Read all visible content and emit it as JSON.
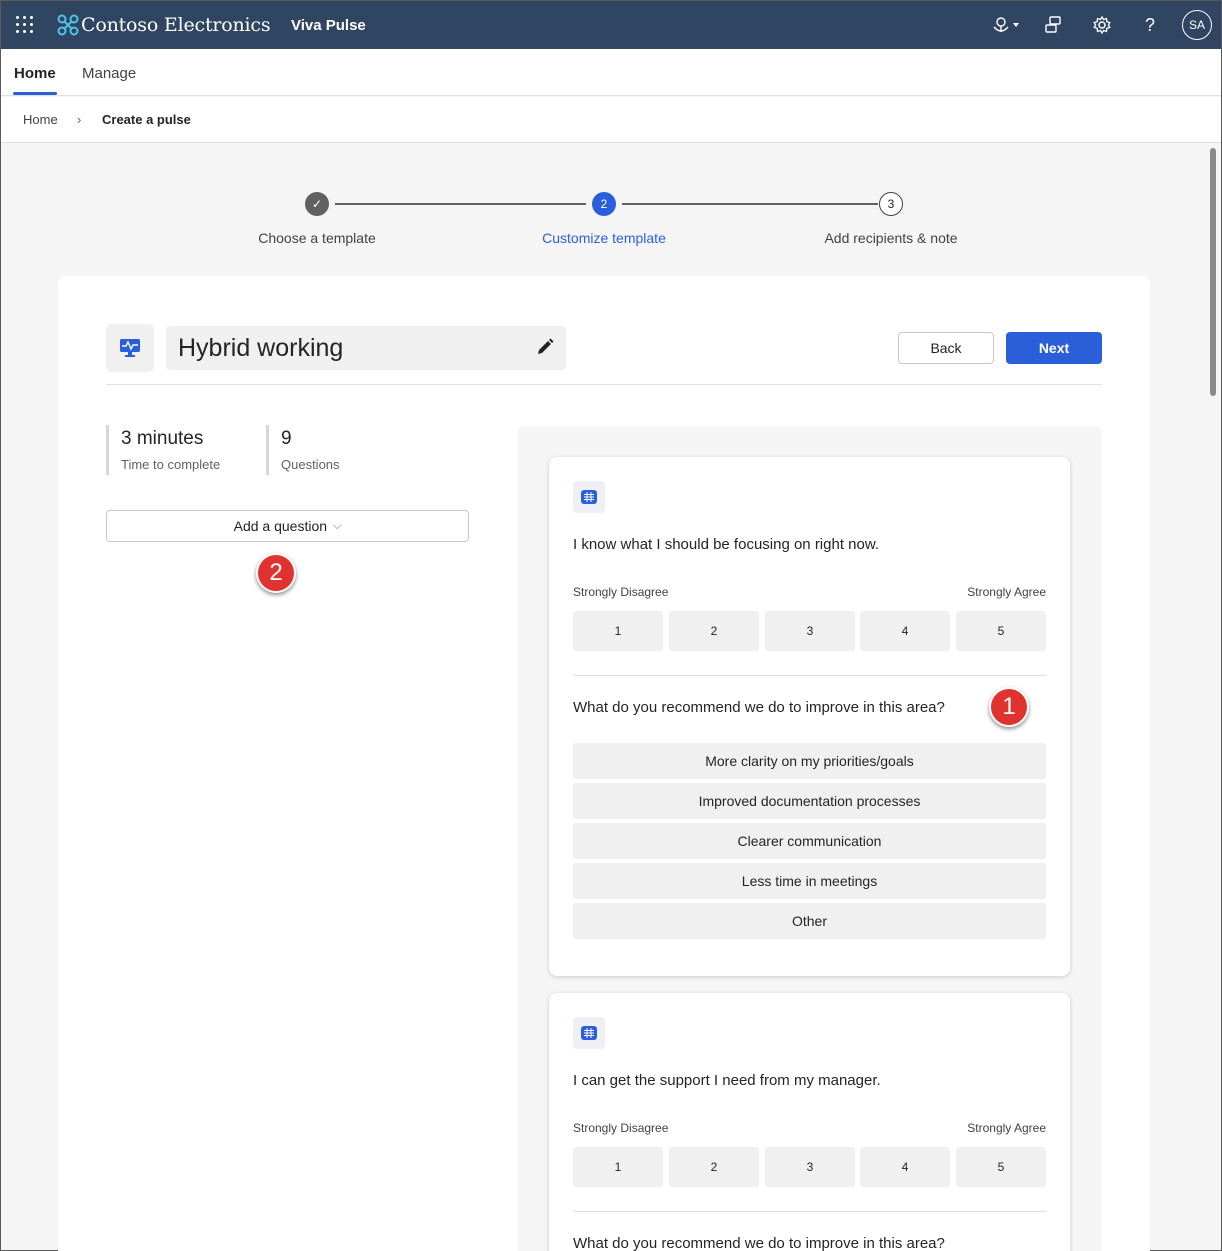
{
  "suitebar": {
    "brand": "Contoso Electronics",
    "app": "Viva Pulse",
    "avatar_initials": "SA",
    "icons": [
      "app-launcher-icon",
      "brand-logo-icon",
      "copilot-icon",
      "feedback-icon",
      "settings-icon",
      "help-icon"
    ],
    "help_glyph": "?"
  },
  "nav": {
    "tabs": [
      {
        "label": "Home",
        "active": true
      },
      {
        "label": "Manage",
        "active": false
      }
    ]
  },
  "breadcrumb": {
    "home": "Home",
    "separator": "›",
    "current": "Create a pulse"
  },
  "stepper": {
    "steps": [
      {
        "label": "Choose a template",
        "state": "complete",
        "marker": "✓"
      },
      {
        "label": "Customize template",
        "state": "active",
        "marker": "2"
      },
      {
        "label": "Add recipients & note",
        "state": "pending",
        "marker": "3"
      }
    ]
  },
  "survey": {
    "title": "Hybrid working",
    "back_label": "Back",
    "next_label": "Next",
    "stats": [
      {
        "value": "3 minutes",
        "label": "Time to complete"
      },
      {
        "value": "9",
        "label": "Questions"
      }
    ],
    "add_question_label": "Add a question",
    "add_question_chevron": "⌵"
  },
  "callouts": [
    "1",
    "2"
  ],
  "questions": [
    {
      "text": "I know what I should be focusing on right now.",
      "scale_low": "Strongly Disagree",
      "scale_high": "Strongly Agree",
      "ratings": [
        "1",
        "2",
        "3",
        "4",
        "5"
      ],
      "followup": "What do you recommend we do to improve in this area?",
      "options": [
        "More clarity on my priorities/goals",
        "Improved documentation processes",
        "Clearer communication",
        "Less time in meetings",
        "Other"
      ]
    },
    {
      "text": "I can get the support I need from my manager.",
      "scale_low": "Strongly Disagree",
      "scale_high": "Strongly Agree",
      "ratings": [
        "1",
        "2",
        "3",
        "4",
        "5"
      ],
      "followup": "What do you recommend we do to improve in this area?"
    }
  ],
  "colors": {
    "suitebar": "#2f4561",
    "accent": "#2b5fd9",
    "callout": "#e0332f"
  }
}
